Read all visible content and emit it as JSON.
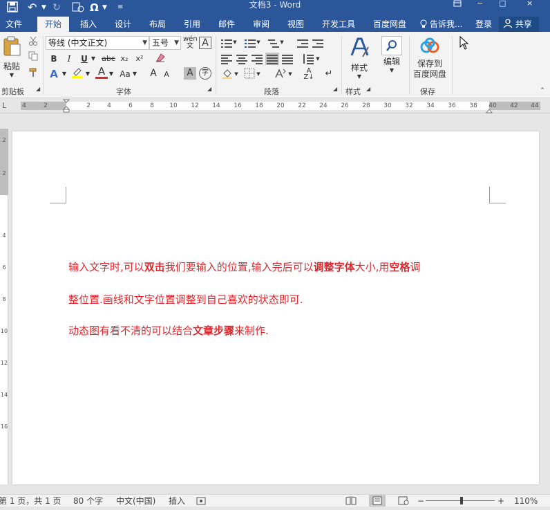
{
  "titlebar": {
    "document_title": "文档3 - Word",
    "undo_symbol": "↶",
    "redo_symbol": "↻",
    "customize_symbol": "Ω",
    "window_controls": [
      "−",
      "□",
      "×"
    ]
  },
  "tabs": [
    "文件",
    "开始",
    "插入",
    "设计",
    "布局",
    "引用",
    "邮件",
    "审阅",
    "视图",
    "开发工具",
    "百度网盘"
  ],
  "tell_me": "告诉我...",
  "login": "登录",
  "share": "共享",
  "ribbon": {
    "clipboard": {
      "paste": "粘贴",
      "label": "剪贴板"
    },
    "font": {
      "font_name": "等线 (中文正文)",
      "font_size": "五号",
      "bold": "B",
      "italic": "I",
      "underline": "U",
      "strike": "abc",
      "subscript": "x₂",
      "superscript": "x²",
      "font_color": "A",
      "change_case": "Aa",
      "grow": "A",
      "shrink": "A",
      "char_shading": "A",
      "enclosed": "字",
      "label": "字体"
    },
    "paragraph": {
      "label": "段落"
    },
    "styles": {
      "button": "样式",
      "label": "样式"
    },
    "editing": {
      "button": "编辑"
    },
    "save": {
      "button_line1": "保存到",
      "button_line2": "百度网盘",
      "label": "保存"
    }
  },
  "ruler": {
    "numbers": [
      "4",
      "2",
      "2",
      "4",
      "6",
      "8",
      "10",
      "12",
      "14",
      "16",
      "18",
      "20",
      "22",
      "24",
      "26",
      "28",
      "30",
      "32",
      "34",
      "36",
      "38",
      "40",
      "42",
      "44"
    ],
    "vnumbers": [
      "2",
      "2",
      "4",
      "6",
      "8",
      "10",
      "12",
      "14",
      "16"
    ]
  },
  "document": {
    "line1": [
      {
        "t": "输入文字时,可以",
        "b": false
      },
      {
        "t": "双击",
        "b": true
      },
      {
        "t": "我们要输入的位置,输入完后可以",
        "b": false
      },
      {
        "t": "调整字体",
        "b": true
      },
      {
        "t": "大小,用",
        "b": false
      },
      {
        "t": "空格",
        "b": true
      },
      {
        "t": "调",
        "b": false
      }
    ],
    "line2": [
      {
        "t": "整位置.画线和文字位置调整到自己喜欢的状态即可.",
        "b": false
      }
    ],
    "line3": [
      {
        "t": "动态图有看不清的可以结合",
        "b": false
      },
      {
        "t": "文章步骤",
        "b": true
      },
      {
        "t": "来制作.",
        "b": false
      }
    ],
    "text_color": "#e0262c"
  },
  "status": {
    "page": "第 1 页，共 1 页",
    "words": "80 个字",
    "language": "中文(中国)",
    "mode": "插入",
    "zoom": "110%"
  },
  "colors": {
    "accent": "#2b579a",
    "ribbon": "#f3f3f3"
  }
}
